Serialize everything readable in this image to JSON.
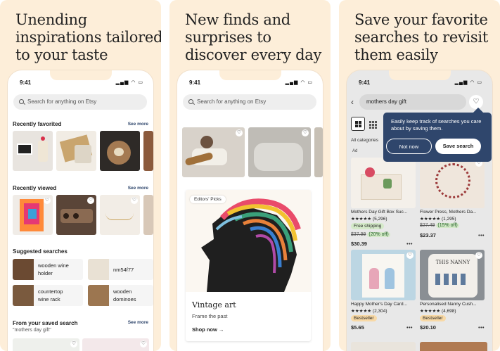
{
  "panels": [
    {
      "headline": "Unending inspirations tailored to your taste",
      "status_time": "9:41",
      "search_placeholder": "Search for anything on Etsy",
      "recently_favorited": {
        "title": "Recently favorited",
        "see_more": "See more"
      },
      "recently_viewed": {
        "title": "Recently viewed",
        "see_more": "See more"
      },
      "suggested": {
        "title": "Suggested searches",
        "items": [
          "wooden wine holder",
          "nm54f77",
          "countertop wine rack",
          "wooden dominoes"
        ]
      },
      "saved_search": {
        "title": "From your saved search",
        "subtitle": "\"mothers day gift\"",
        "see_more": "See more"
      }
    },
    {
      "headline": "New finds and surprises to discover every day",
      "status_time": "9:41",
      "search_placeholder": "Search for anything on Etsy",
      "feature": {
        "badge": "Editors' Picks",
        "title": "Vintage art",
        "subtitle": "Frame the past",
        "link": "Shop now →"
      }
    },
    {
      "headline": "Save your favorite searches to revisit them easily",
      "status_time": "9:41",
      "query": "mothers day gift",
      "all_categories": "All categories",
      "tooltip": {
        "text": "Easily keep track of searches you care about by saving them.",
        "not_now": "Not now",
        "save": "Save search"
      },
      "products": [
        {
          "ad": "Ad",
          "title": "Mothers Day Gift Box Suc...",
          "stars": "★★★★★ (5,296)",
          "tag": "Free shipping",
          "old_price": "$37.99",
          "discount": "(20% off)",
          "price": "$30.39",
          "more": "•••"
        },
        {
          "ad": "",
          "title": "Flower Press, Mothers Da...",
          "stars": "★★★★★ (1,295)",
          "tag": "",
          "old_price": "$27.49",
          "discount": "(15% off)",
          "price": "$23.37",
          "more": "•••"
        },
        {
          "ad": "",
          "title": "Happy Mother's Day Card...",
          "stars": "★★★★★ (2,304)",
          "tag": "Bestseller",
          "old_price": "",
          "discount": "",
          "price": "$5.65",
          "more": "•••"
        },
        {
          "ad": "",
          "title": "Personalised Nanny Cush...",
          "stars": "★★★★★ (4,698)",
          "tag": "Bestseller",
          "old_price": "",
          "discount": "",
          "price": "$20.10",
          "more": "•••"
        }
      ]
    }
  ],
  "colors": {
    "panel_bg": "#fdeed9",
    "navy": "#2f466c",
    "green_tag": "#d4e9c8",
    "orange_tag": "#f8d9a6"
  },
  "icons": {
    "heart": "heart-icon",
    "search": "search-icon",
    "back": "back-arrow-icon",
    "grid": "grid-view-icon",
    "list": "list-view-icon"
  }
}
